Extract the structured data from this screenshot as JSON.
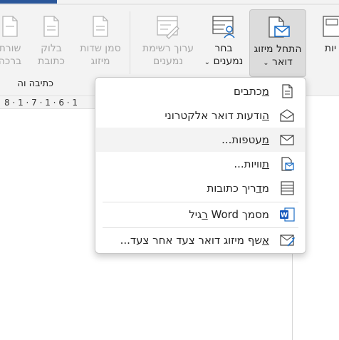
{
  "ribbon": {
    "buttons": [
      {
        "name": "start-mail-merge-button",
        "line1": "התחל מיזוג",
        "line2": "דואר ",
        "caret": "⌄",
        "disabled": false,
        "active": true
      },
      {
        "name": "select-recipients-button",
        "line1": "בחר",
        "line2": "נמענים ",
        "caret": "⌄",
        "disabled": false,
        "active": false
      },
      {
        "name": "edit-recipient-list-button",
        "line1": "ערוך רשימת",
        "line2": "נמענים",
        "disabled": true
      },
      {
        "name": "highlight-merge-fields-button",
        "line1": "סמן שדות",
        "line2": "מיזוג",
        "disabled": true
      },
      {
        "name": "address-block-button",
        "line1": "בלוק",
        "line2": "כתובת",
        "disabled": true
      },
      {
        "name": "greeting-line-button",
        "line1": "שורת",
        "line2": "ברכה",
        "disabled": true
      },
      {
        "name": "partial-create-button",
        "line1": "יות",
        "line2": ""
      }
    ],
    "group_label": "כתיבה וה"
  },
  "ruler": {
    "text": "8 · 1 · 7 · 1 · 6 · 1"
  },
  "menu": {
    "items": [
      {
        "name": "letters-item",
        "accel": "מ",
        "rest": "כתבים",
        "icon": "doc-icon"
      },
      {
        "name": "email-messages-item",
        "accel": "ה",
        "rest": "ודעות דואר אלקטרוני",
        "icon": "open-envelope-icon"
      },
      {
        "name": "envelopes-item",
        "accel": "מ",
        "rest": "עטפות...",
        "icon": "envelope-icon",
        "hover": true
      },
      {
        "name": "labels-item",
        "accel": "ת",
        "rest": "וויות...",
        "icon": "label-sheet-icon"
      },
      {
        "name": "directory-item",
        "pre": "מ",
        "accel": "ד",
        "rest": "ריך כתובות",
        "icon": "directory-icon"
      },
      {
        "name": "normal-word-document-item",
        "pre": "מסמך Word ",
        "accel": "ר",
        "rest": "גיל",
        "icon": "word-doc-icon"
      },
      {
        "name": "step-by-step-wizard-item",
        "accel": "א",
        "rest": "שף מיזוג דואר צעד אחר צעד...",
        "icon": "wizard-icon"
      }
    ]
  }
}
